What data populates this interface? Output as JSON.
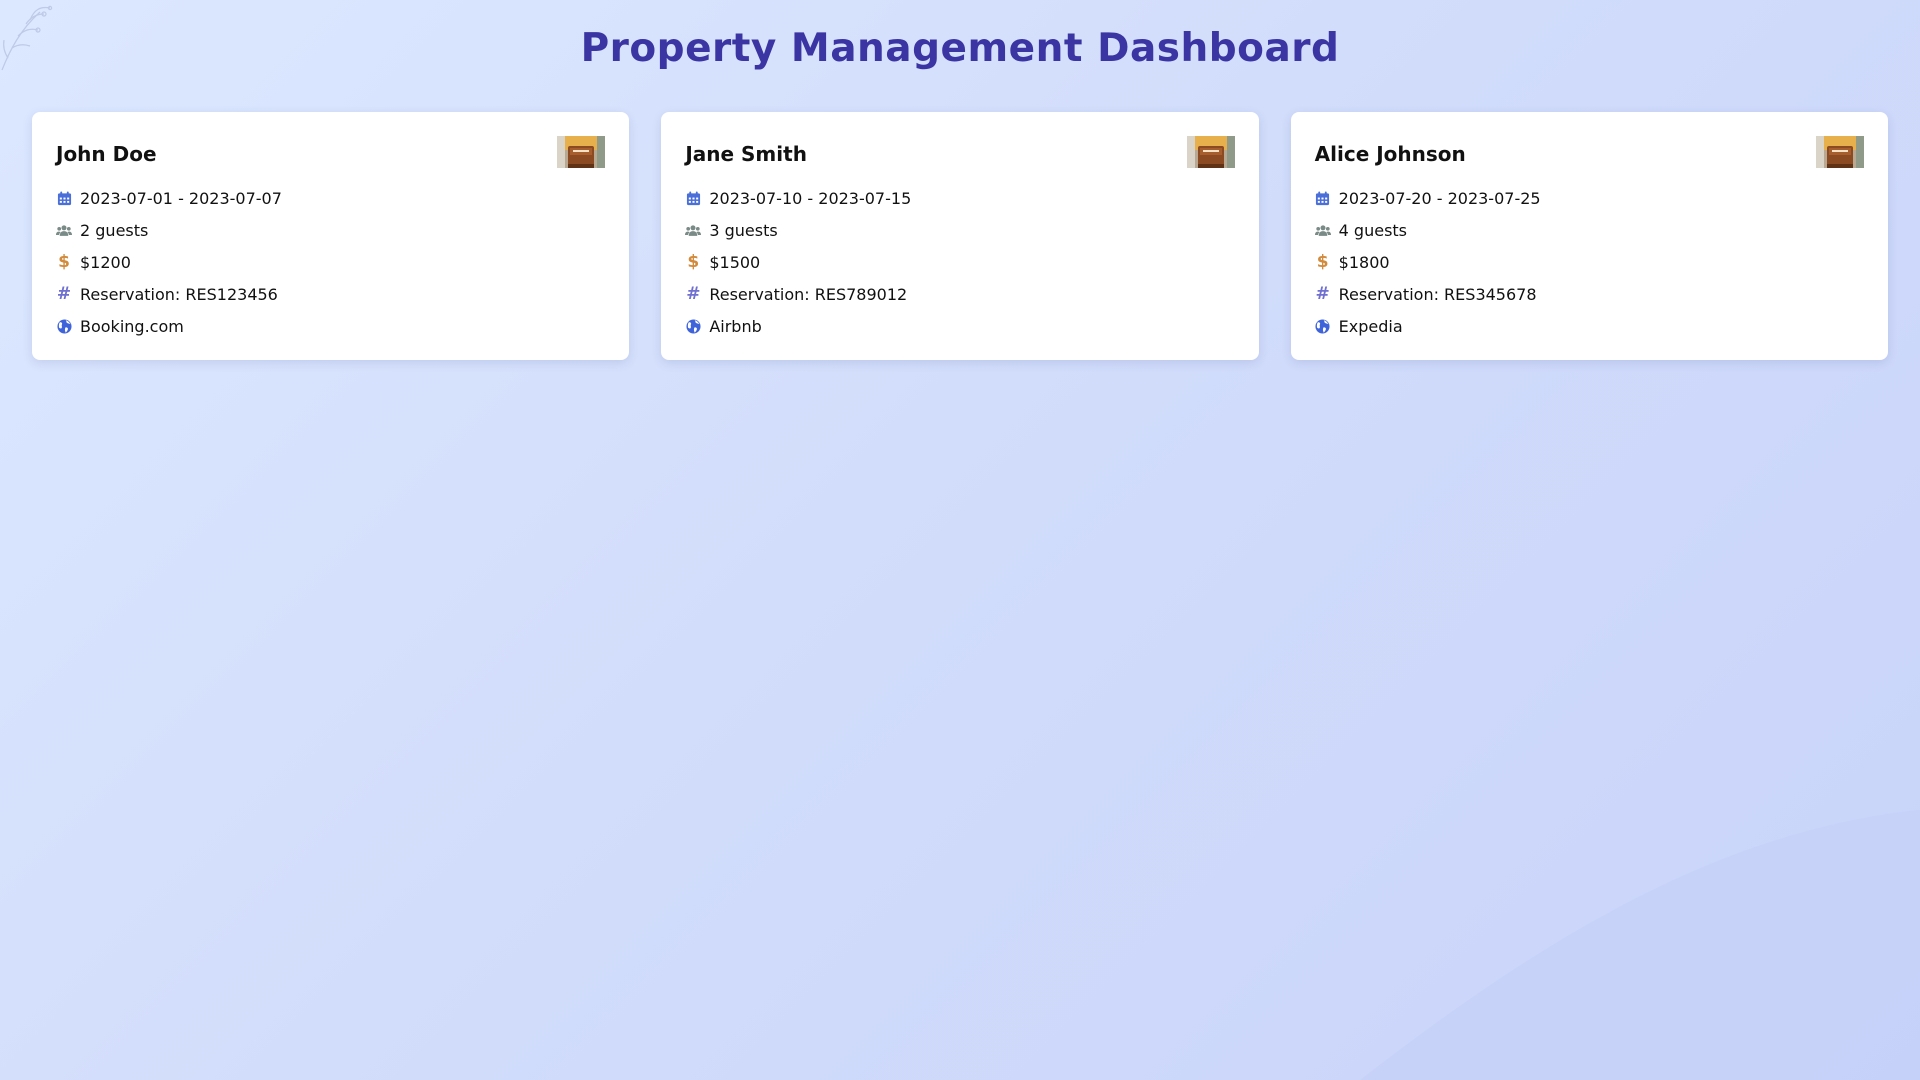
{
  "page": {
    "title": "Property Management Dashboard"
  },
  "theme": {
    "title_color": "#3a35a3",
    "calendar_icon_color": "#4a6fd8",
    "guests_icon_color": "#7a8a86",
    "price_icon_color": "#d28a3c",
    "reservation_icon_color": "#7070d0",
    "platform_icon_color": "#3f63d8"
  },
  "icons": {
    "dates": "calendar-icon",
    "guests": "users-icon",
    "price": "dollar-icon",
    "reservation": "hash-icon",
    "platform": "globe-icon",
    "thumbnail": "property-photo"
  },
  "bookings": [
    {
      "guest_name": "John Doe",
      "dates": "2023-07-01 - 2023-07-07",
      "guests": "2 guests",
      "price": "$1200",
      "reservation": "Reservation: RES123456",
      "platform": "Booking.com"
    },
    {
      "guest_name": "Jane Smith",
      "dates": "2023-07-10 - 2023-07-15",
      "guests": "3 guests",
      "price": "$1500",
      "reservation": "Reservation: RES789012",
      "platform": "Airbnb"
    },
    {
      "guest_name": "Alice Johnson",
      "dates": "2023-07-20 - 2023-07-25",
      "guests": "4 guests",
      "price": "$1800",
      "reservation": "Reservation: RES345678",
      "platform": "Expedia"
    }
  ]
}
